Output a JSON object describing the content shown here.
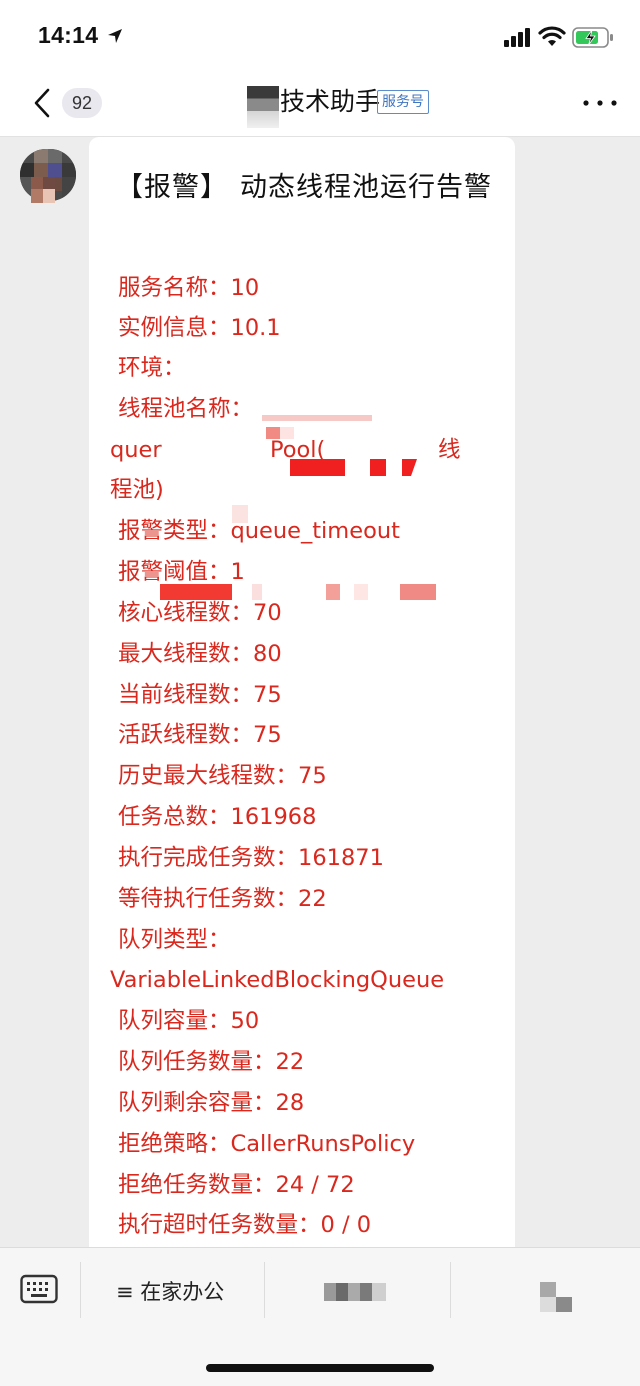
{
  "status_bar": {
    "time": "14:14",
    "icons": [
      "location-arrow-icon",
      "cellular-signal-icon",
      "wifi-icon",
      "battery-charging-icon"
    ]
  },
  "nav": {
    "unread_count": "92",
    "title": "技术助手",
    "tag": "服务号"
  },
  "message": {
    "title_tag": "【报警】",
    "title": "动态线程池运行告警",
    "fields": {
      "service_name": "服务名称：10",
      "instance_info": "实例信息：10.1",
      "env": "环境：",
      "pool_name_label": "线程池名称：",
      "pool_name_part1": "quer",
      "pool_name_part2": "Pool(",
      "pool_name_part3": "线",
      "pool_name_line2": "程池)",
      "alarm_type": "报警类型：queue_timeout",
      "alarm_threshold": "报警阈值：1",
      "core_threads": "核心线程数：70",
      "max_threads": "最大线程数：80",
      "current_threads": "当前线程数：75",
      "active_threads": "活跃线程数：75",
      "history_max_threads": "历史最大线程数：75",
      "task_total": "任务总数：161968",
      "completed_tasks": "执行完成任务数：161871",
      "waiting_tasks": "等待执行任务数：22",
      "queue_type_label": "队列类型：",
      "queue_type_value": "VariableLinkedBlockingQueue",
      "queue_capacity": "队列容量：50",
      "queue_size": "队列任务数量：22",
      "queue_remaining": "队列剩余容量：28",
      "reject_policy": "拒绝策略：CallerRunsPolicy",
      "reject_count": "拒绝任务数量：24 / 72",
      "timeout_count": "执行超时任务数量：0 / 0"
    }
  },
  "bottom_bar": {
    "menu_1": "≡ 在家办公"
  },
  "colors": {
    "alert_red": "#d9281e",
    "background": "#ededed",
    "bubble": "#ffffff",
    "tag_blue": "#3f75c1"
  }
}
